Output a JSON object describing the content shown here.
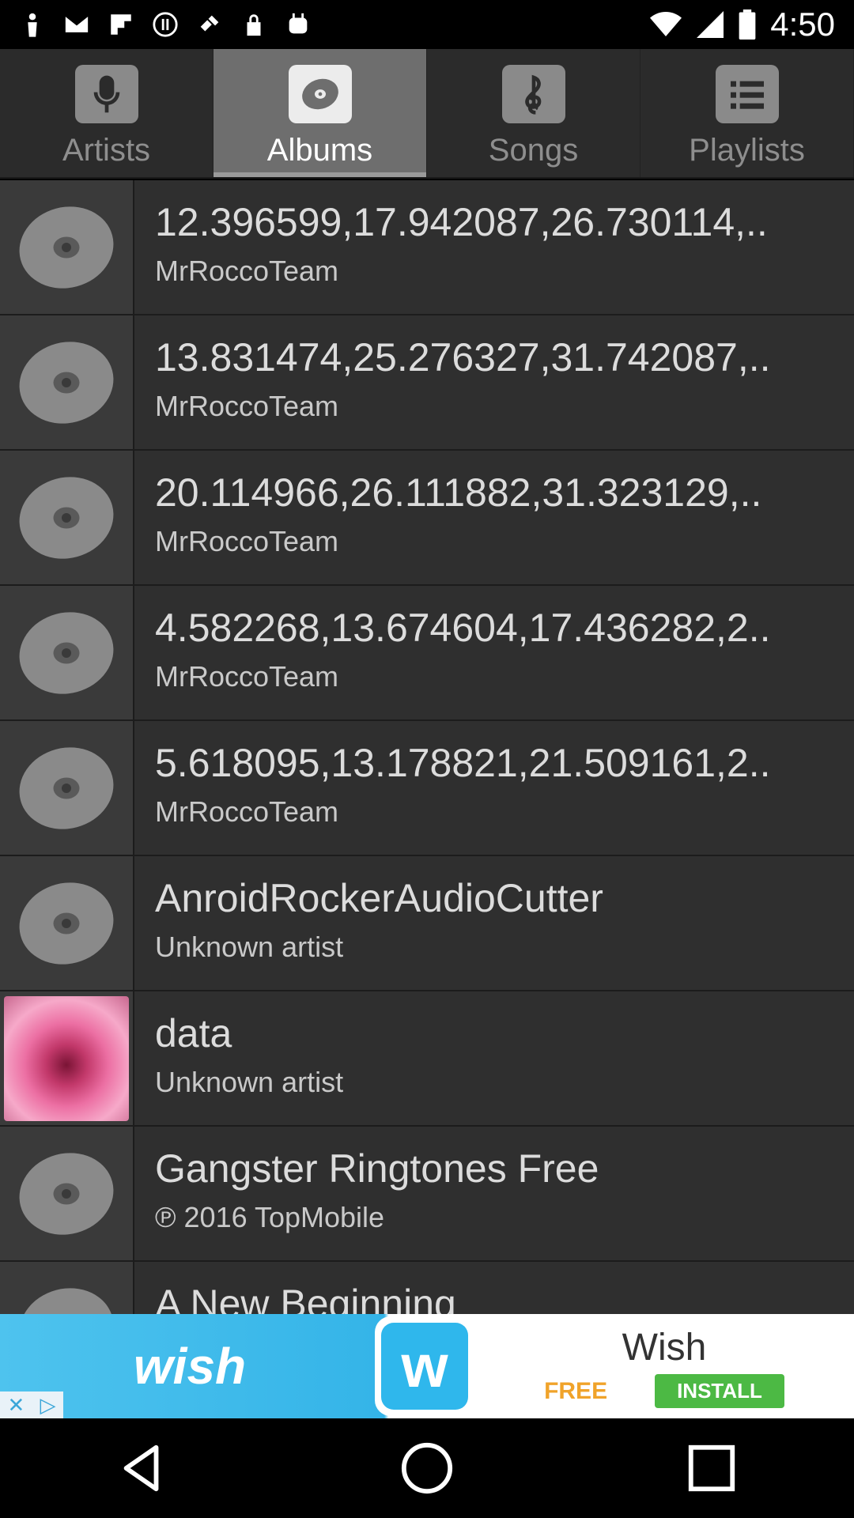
{
  "status_bar": {
    "time": "4:50"
  },
  "tabs": [
    {
      "label": "Artists",
      "icon": "microphone-icon",
      "active": false
    },
    {
      "label": "Albums",
      "icon": "album-disc-icon",
      "active": true
    },
    {
      "label": "Songs",
      "icon": "treble-clef-icon",
      "active": false
    },
    {
      "label": "Playlists",
      "icon": "playlist-icon",
      "active": false
    }
  ],
  "albums": [
    {
      "title": "12.396599,17.942087,26.730114,..",
      "subtitle": "MrRoccoTeam",
      "art": "disc"
    },
    {
      "title": "13.831474,25.276327,31.742087,..",
      "subtitle": "MrRoccoTeam",
      "art": "disc"
    },
    {
      "title": "20.114966,26.111882,31.323129,..",
      "subtitle": "MrRoccoTeam",
      "art": "disc"
    },
    {
      "title": "4.582268,13.674604,17.436282,2..",
      "subtitle": "MrRoccoTeam",
      "art": "disc"
    },
    {
      "title": "5.618095,13.178821,21.509161,2..",
      "subtitle": "MrRoccoTeam",
      "art": "disc"
    },
    {
      "title": "AnroidRockerAudioCutter",
      "subtitle": "Unknown artist",
      "art": "disc"
    },
    {
      "title": "data",
      "subtitle": "Unknown artist",
      "art": "rose-photo"
    },
    {
      "title": "Gangster Ringtones Free",
      "subtitle": "℗ 2016 TopMobile",
      "art": "disc"
    },
    {
      "title": "A New Beginning",
      "subtitle": "",
      "art": "disc"
    }
  ],
  "ad": {
    "wordmark": "wish",
    "logo_letter": "w",
    "title": "Wish",
    "free_label": "FREE",
    "install_label": "INSTALL"
  },
  "colors": {
    "active_tab": "#6e6e6e",
    "list_bg": "#2f2f2f",
    "ad_blue": "#34b4e8",
    "install_green": "#4cb944"
  }
}
